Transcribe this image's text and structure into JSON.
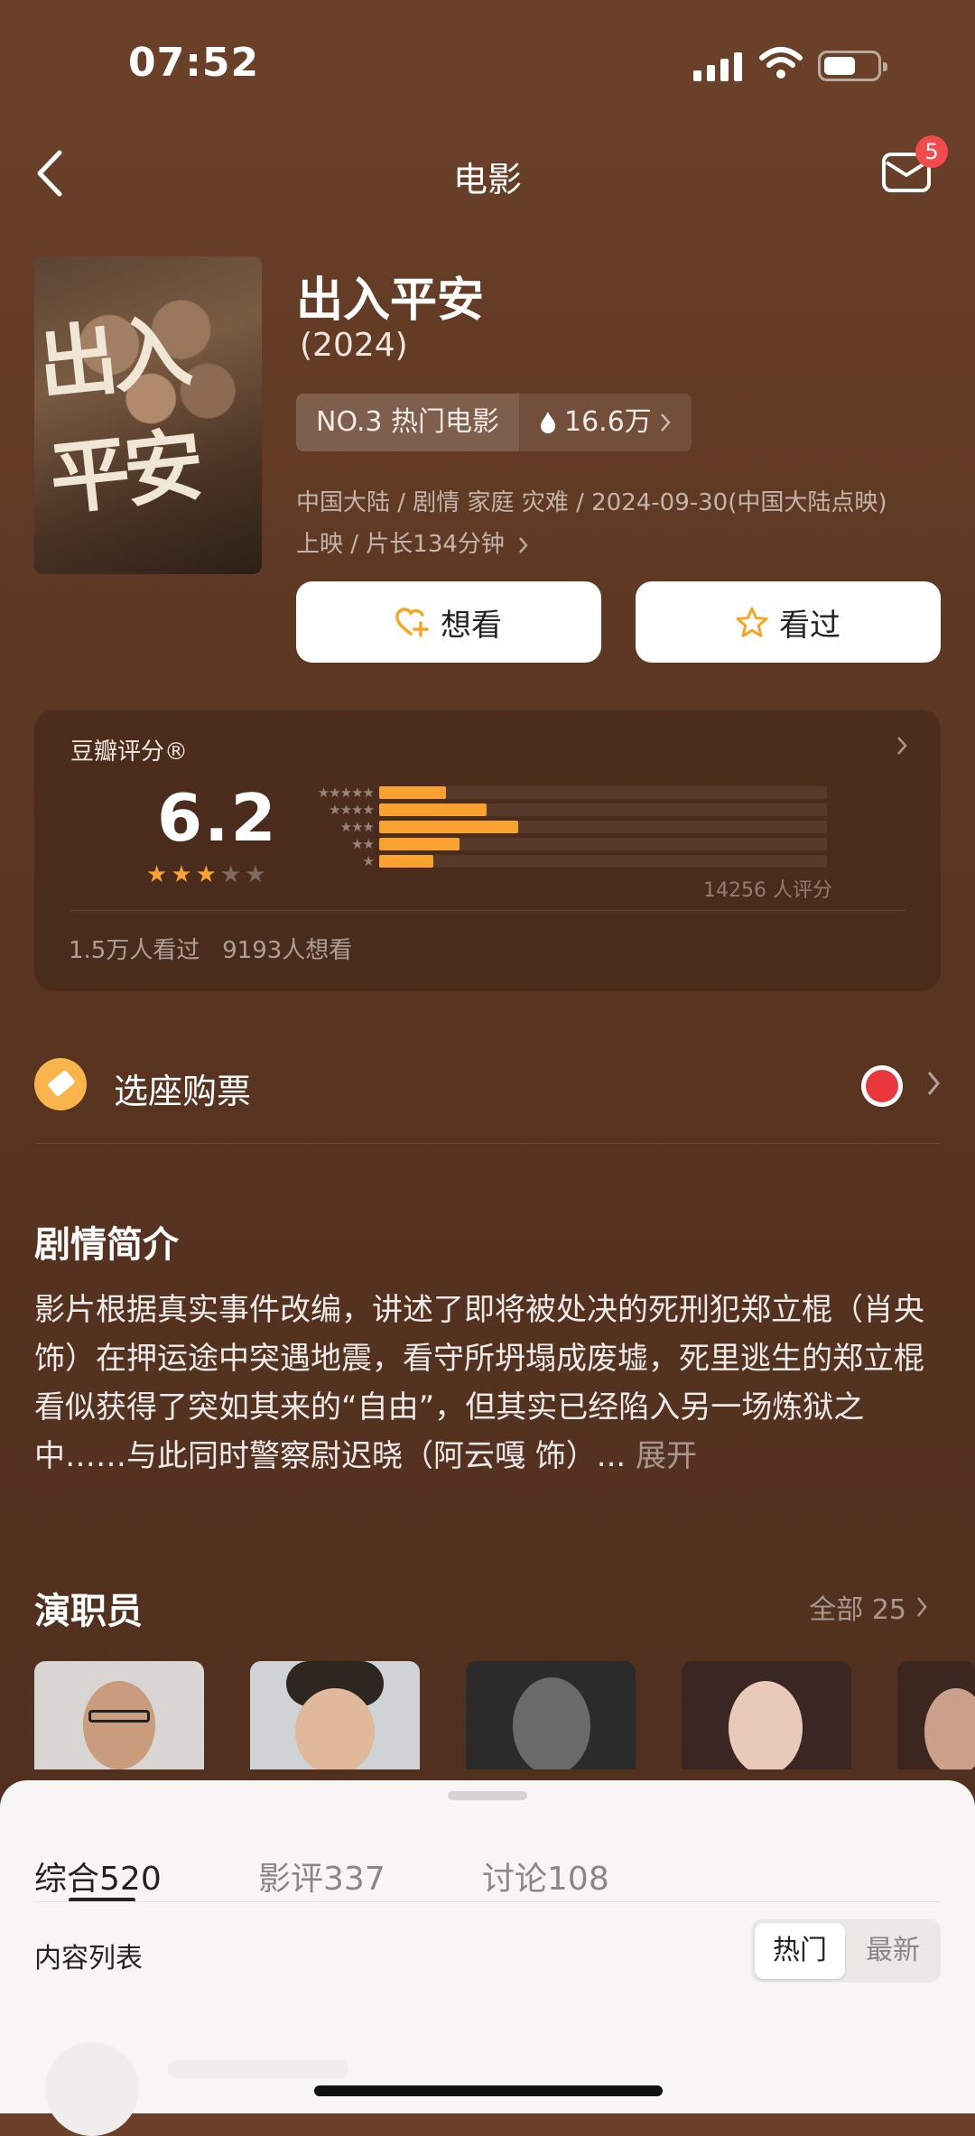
{
  "status_bar": {
    "time": "07:52",
    "battery_level": 0.55
  },
  "nav": {
    "title": "电影",
    "badge": "5",
    "back_icon": "chevron-left-icon",
    "mail_icon": "mail-icon"
  },
  "movie": {
    "title": "出入平安",
    "year": "(2024)",
    "rank_label": "NO.3 热门电影",
    "heat": "16.6万",
    "meta_line1": "中国大陆 / 剧情 家庭 灾难 / 2024-09-30(中国大陆点映)",
    "meta_line2": "上映 / 片长134分钟",
    "poster_title": "出入平安"
  },
  "actions": {
    "want": "想看",
    "watched": "看过"
  },
  "rating": {
    "label": "豆瓣评分®",
    "score": "6.2",
    "stars": 3,
    "count_text": "14256 人评分",
    "distribution": [
      0.15,
      0.24,
      0.31,
      0.18,
      0.12
    ],
    "foot": "1.5万人看过   9193人想看"
  },
  "ticket": {
    "label": "选座购票"
  },
  "synopsis": {
    "title": "剧情简介",
    "text": "影片根据真实事件改编，讲述了即将被处决的死刑犯郑立棍（肖央 饰）在押运途中突遇地震，看守所坍塌成废墟，死里逃生的郑立棍看似获得了突如其来的“自由”，但其实已经陷入另一场炼狱之中……与此同时警察尉迟晓（阿云嘎 饰）...",
    "more": "展开"
  },
  "cast": {
    "title": "演职员",
    "all_label": "全部 25"
  },
  "sheet": {
    "tabs": [
      {
        "label": "综合",
        "count": "520"
      },
      {
        "label": "影评",
        "count": "337"
      },
      {
        "label": "讨论",
        "count": "108"
      }
    ],
    "list_label": "内容列表",
    "sort_hot": "热门",
    "sort_new": "最新"
  },
  "colors": {
    "accent": "#f9a22f",
    "badge": "#f24b4b",
    "background": "#5e3823"
  }
}
